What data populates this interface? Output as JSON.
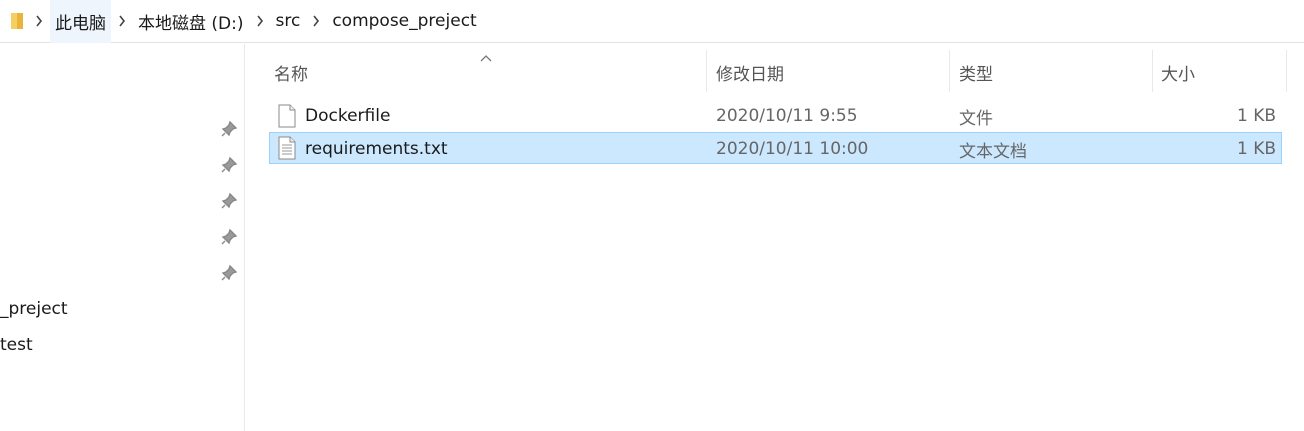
{
  "address": {
    "crumbs": [
      "此电脑",
      "本地磁盘 (D:)",
      "src",
      "compose_preject"
    ]
  },
  "nav": {
    "items": [
      "_preject",
      "test"
    ],
    "pin_count": 5
  },
  "columns": {
    "name": "名称",
    "date": "修改日期",
    "type": "类型",
    "size": "大小"
  },
  "files": [
    {
      "name": "Dockerfile",
      "date": "2020/10/11 9:55",
      "type": "文件",
      "size": "1 KB",
      "icon": "generic-file-icon",
      "selected": false
    },
    {
      "name": "requirements.txt",
      "date": "2020/10/11 10:00",
      "type": "文本文档",
      "size": "1 KB",
      "icon": "text-file-icon",
      "selected": true
    }
  ],
  "colors": {
    "selected_bg": "#cce8ff",
    "selected_border": "#99d1ff",
    "breadcrumb_hover": "#eef5fd"
  }
}
